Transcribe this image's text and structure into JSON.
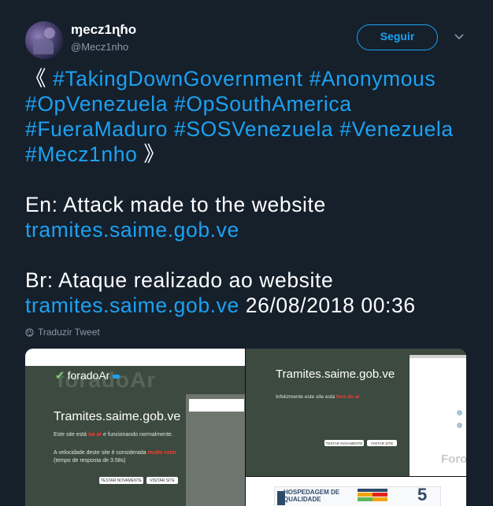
{
  "user": {
    "display_name": "ɱecz1ɳɦo",
    "handle": "@Mecz1nho"
  },
  "follow_button": {
    "label": "Seguir"
  },
  "tweet": {
    "lines": [
      [
        {
          "t": "text",
          "v": "《 "
        },
        {
          "t": "tag",
          "v": "#TakingDownGovernment"
        },
        {
          "t": "text",
          "v": " "
        },
        {
          "t": "tag",
          "v": "#Anonymous"
        }
      ],
      [
        {
          "t": "tag",
          "v": "#OpVenezuela"
        },
        {
          "t": "text",
          "v": " "
        },
        {
          "t": "tag",
          "v": "#OpSouthAmerica"
        }
      ],
      [
        {
          "t": "tag",
          "v": "#FueraMaduro"
        },
        {
          "t": "text",
          "v": " "
        },
        {
          "t": "tag",
          "v": "#SOSVenezuela"
        },
        {
          "t": "text",
          "v": " "
        },
        {
          "t": "tag",
          "v": "#Venezuela"
        }
      ],
      [
        {
          "t": "tag",
          "v": "#Mecz1nho"
        },
        {
          "t": "text",
          "v": " 》"
        }
      ],
      [],
      [
        {
          "t": "text",
          "v": "En: Attack made to the website"
        }
      ],
      [
        {
          "t": "text",
          "v": " "
        },
        {
          "t": "link",
          "v": "tramites.saime.gob.ve"
        }
      ],
      [],
      [
        {
          "t": "text",
          "v": "Br: Ataque realizado ao website"
        }
      ],
      [
        {
          "t": "text",
          "v": " "
        },
        {
          "t": "link",
          "v": "tramites.saime.gob.ve"
        },
        {
          "t": "text",
          "v": " 26/08/2018  00:36"
        }
      ]
    ]
  },
  "translate": {
    "label": "Traduzir Tweet"
  },
  "media": {
    "shot1": {
      "brand": "foradoAr",
      "brand_bg": "foradoAr",
      "title": "Tramites.saime.gob.ve",
      "status_prefix": "Este site está ",
      "status_red": "no ar",
      "status_suffix": " e funcionando normalmente.",
      "speed_prefix": "A velocidade deste site é considerada ",
      "speed_red": "muito ruim",
      "speed_time": "(tempo de resposta de 3.58s)",
      "btn1": "TESTAR NOVAMENTE",
      "btn2": "VISITAR SITE"
    },
    "shot2": {
      "title": "Tramites.saime.gob.ve",
      "status_prefix": "Infelizmente este site está ",
      "status_red": "fora do ar",
      "btn1": "TESTAR NOVAMENTE",
      "btn2": "VISITAR SITE",
      "foro": "Foro"
    },
    "shot3": {
      "ad_line1": "HOSPEDAGEM DE",
      "ad_line2": "QUALIDADE",
      "five": "5"
    }
  },
  "colors": {
    "accent": "#1da1f2",
    "background": "#15202b",
    "muted": "#8899a6",
    "alert": "#e0241b"
  }
}
